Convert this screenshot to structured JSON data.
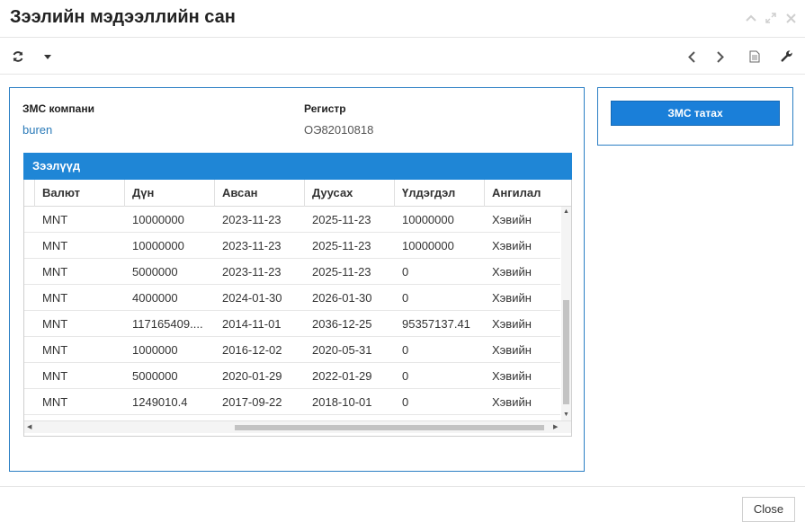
{
  "dialog": {
    "title": "Зээлийн мэдээллийн сан"
  },
  "toolbar": {
    "icons": [
      "refresh-icon",
      "caret-down-icon",
      "chevron-left-icon",
      "chevron-right-icon",
      "document-icon",
      "wrench-icon"
    ]
  },
  "company": {
    "label": "ЗМС компани",
    "value": "buren",
    "register_label": "Регистр",
    "register_value": "ОЭ82010818"
  },
  "loans": {
    "title": "Зээлүүд",
    "columns": [
      "Валют",
      "Дүн",
      "Авсан",
      "Дуусах",
      "Үлдэгдэл",
      "Ангилал"
    ],
    "rows": [
      [
        "MNT",
        "10000000",
        "2023-11-23",
        "2025-11-23",
        "10000000",
        "Хэвийн"
      ],
      [
        "MNT",
        "10000000",
        "2023-11-23",
        "2025-11-23",
        "10000000",
        "Хэвийн"
      ],
      [
        "MNT",
        "5000000",
        "2023-11-23",
        "2025-11-23",
        "0",
        "Хэвийн"
      ],
      [
        "MNT",
        "4000000",
        "2024-01-30",
        "2026-01-30",
        "0",
        "Хэвийн"
      ],
      [
        "MNT",
        "117165409....",
        "2014-11-01",
        "2036-12-25",
        "95357137.41",
        "Хэвийн"
      ],
      [
        "MNT",
        "1000000",
        "2016-12-02",
        "2020-05-31",
        "0",
        "Хэвийн"
      ],
      [
        "MNT",
        "5000000",
        "2020-01-29",
        "2022-01-29",
        "0",
        "Хэвийн"
      ],
      [
        "MNT",
        "1249010.4",
        "2017-09-22",
        "2018-10-01",
        "0",
        "Хэвийн"
      ]
    ]
  },
  "side": {
    "button_label": "ЗМС татах"
  },
  "footer": {
    "close_label": "Close"
  },
  "colors": {
    "accent": "#1f86d6",
    "border": "#2b7fc4",
    "link": "#2a7ab8"
  }
}
